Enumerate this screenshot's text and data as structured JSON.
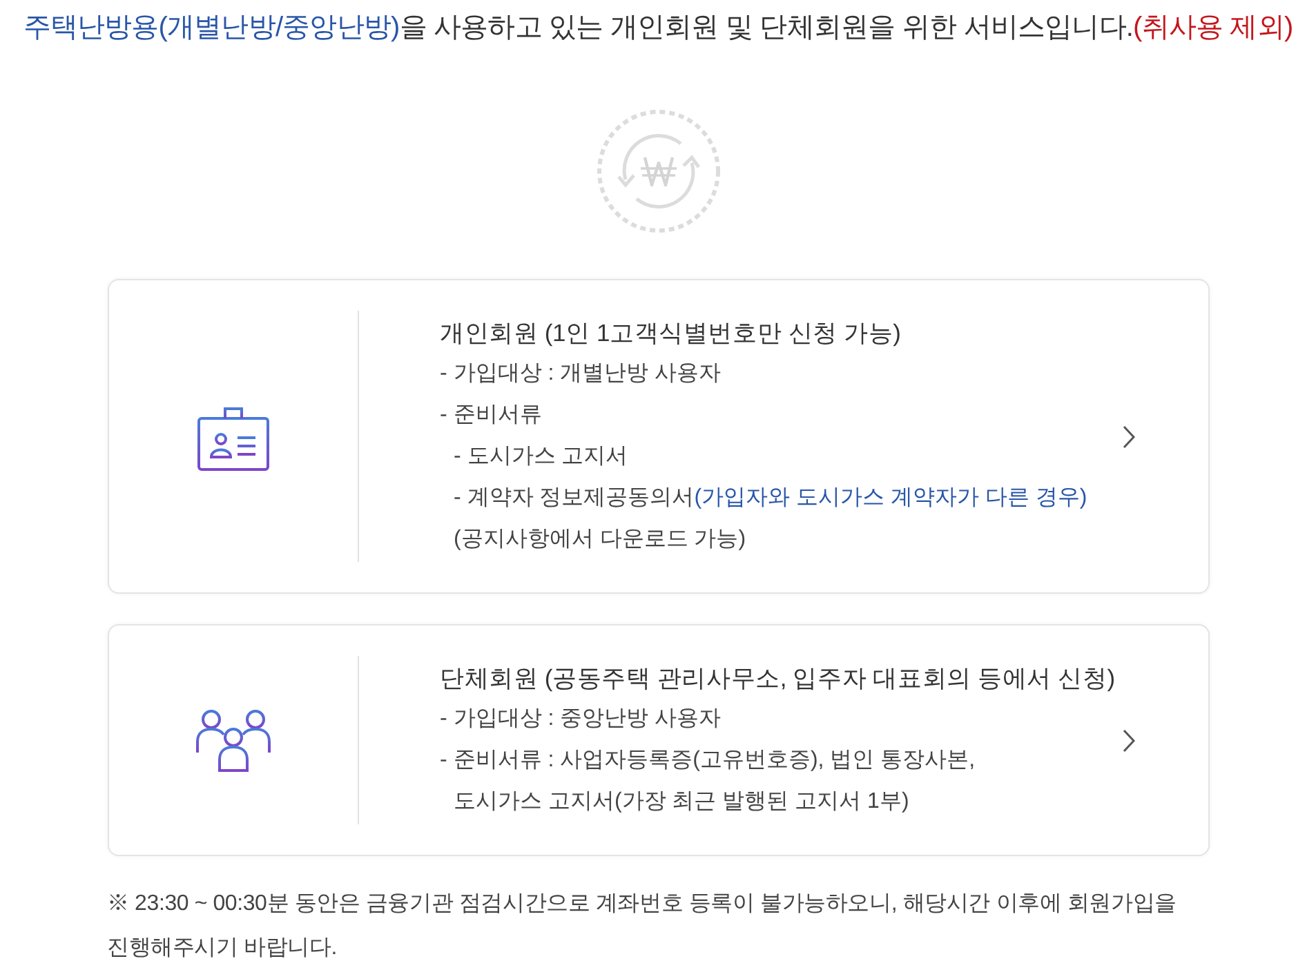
{
  "intro": {
    "segments": [
      {
        "text": "주택난방용(개별난방/중앙난방)",
        "kind": "accent"
      },
      {
        "text": "을 사용하고 있는 개인회원 및 단체회원을 위한 서비스입니다.",
        "kind": "plain"
      },
      {
        "text": "(취사용 제외)",
        "kind": "alert"
      }
    ]
  },
  "cards": [
    {
      "kind": "individual",
      "title": "개인회원 (1인 1고객식별번호만 신청 가능)",
      "lines": [
        {
          "segments": [
            {
              "text": "- 가입대상 : 개별난방 사용자",
              "kind": "plain"
            }
          ]
        },
        {
          "segments": [
            {
              "text": "- 준비서류",
              "kind": "plain"
            }
          ],
          "children": [
            {
              "segments": [
                {
                  "text": "- 도시가스 고지서",
                  "kind": "plain"
                }
              ]
            },
            {
              "segments": [
                {
                  "text": "- 계약자 정보제공동의서",
                  "kind": "plain"
                },
                {
                  "text": "(가입자와 도시가스 계약자가 다른 경우)",
                  "kind": "accent"
                }
              ]
            },
            {
              "segments": [
                {
                  "text": "(공지사항에서 다운로드 가능)",
                  "kind": "plain"
                }
              ]
            }
          ]
        }
      ]
    },
    {
      "kind": "group",
      "title": "단체회원 (공동주택 관리사무소, 입주자 대표회의 등에서 신청)",
      "lines": [
        {
          "segments": [
            {
              "text": "- 가입대상 : 중앙난방 사용자",
              "kind": "plain"
            }
          ]
        },
        {
          "segments": [
            {
              "text": "- 준비서류 : 사업자등록증(고유번호증), 법인 통장사본,",
              "kind": "plain"
            }
          ],
          "children": [
            {
              "segments": [
                {
                  "text": "도시가스 고지서(가장 최근 발행된 고지서 1부)",
                  "kind": "plain"
                }
              ]
            }
          ]
        }
      ]
    }
  ],
  "notice": "※ 23:30 ~ 00:30분 동안은 금융기관 점검시간으로 계좌번호 등록이 불가능하오니, 해당시간 이후에 회원가입을 진행해주시기 바랍니다."
}
